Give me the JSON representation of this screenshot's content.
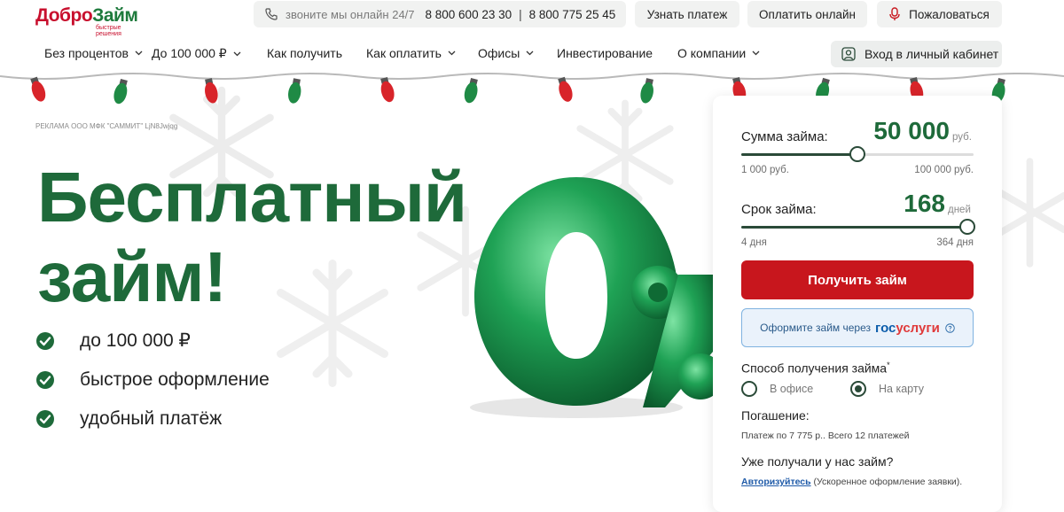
{
  "logo": {
    "text_part1": "Добро",
    "text_part2": "Займ",
    "tagline": "быстрые решения"
  },
  "header": {
    "call_text": "звоните мы онлайн 24/7",
    "phone1": "8 800 600 23 30",
    "phone_sep": "|",
    "phone2": "8 800 775 25 45",
    "btn_payment": "Узнать платеж",
    "btn_pay_online": "Оплатить онлайн",
    "btn_complain": "Пожаловаться"
  },
  "nav": {
    "items": [
      {
        "label": "Без процентов"
      },
      {
        "label": "До 100 000 ₽"
      },
      {
        "label": "Как получить"
      },
      {
        "label": "Как оплатить"
      },
      {
        "label": "Офисы"
      },
      {
        "label": "Инвестирование"
      },
      {
        "label": "О компании"
      }
    ],
    "login": "Вход в личный кабинет"
  },
  "hero": {
    "ad_notice": "РЕКЛАМА ООО МФК \"САММИТ\" LjN8Jwjqg",
    "title_line1": "Бесплатный",
    "title_line2": "займ!",
    "features": [
      "до 100 000 ₽",
      "быстрое оформление",
      "удобный платёж"
    ]
  },
  "calculator": {
    "amount_label": "Сумма займа:",
    "amount_value": "50 000",
    "amount_unit": "руб.",
    "amount_min": "1 000 руб.",
    "amount_max": "100 000 руб.",
    "amount_fraction": 0.5,
    "term_label": "Срок займа:",
    "term_value": "168",
    "term_unit": "дней",
    "term_min": "4 дня",
    "term_max": "364 дня",
    "term_fraction": 1.0,
    "submit": "Получить займ",
    "gosuslugi_prefix": "Оформите займ через",
    "gosuslugi_part1": "гос",
    "gosuslugi_part2": "услуги",
    "method_label": "Способ получения займа",
    "method_required": "*",
    "method_office": "В офисе",
    "method_card": "На карту",
    "method_selected": "card",
    "repayment_label": "Погашение:",
    "repayment_text": "Платеж по 7 775 р.. Всего 12 платежей",
    "returning_label": "Уже получали у нас займ?",
    "auth_link": "Авторизуйтесь",
    "auth_text": " (Ускоренное оформление заявки)."
  },
  "colors": {
    "brand_green": "#1e6a3a",
    "brand_red": "#c8161d",
    "gos_blue": "#0c5dab"
  }
}
